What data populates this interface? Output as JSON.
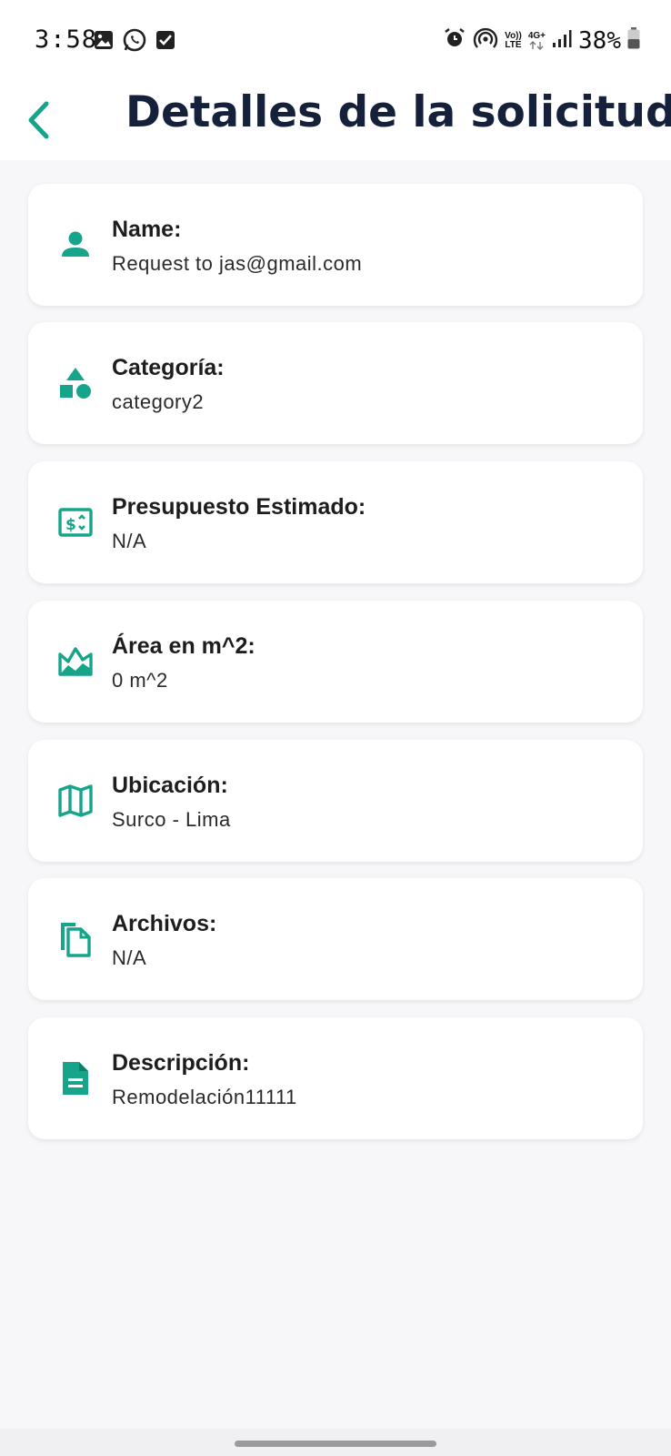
{
  "status_bar": {
    "time": "3:58",
    "battery": "38%",
    "network": "4G+",
    "volte_top": "Vo))",
    "volte_bottom": "LTE"
  },
  "header": {
    "title": "Detalles de la solicitud"
  },
  "accent_color": "#16a58b",
  "cards": [
    {
      "icon": "person-icon",
      "label": "Name:",
      "value": "Request to jas@gmail.com"
    },
    {
      "icon": "category-icon",
      "label": "Categoría:",
      "value": "category2"
    },
    {
      "icon": "money-icon",
      "label": "Presupuesto Estimado:",
      "value": "N/A"
    },
    {
      "icon": "area-chart-icon",
      "label": "Área en m^2:",
      "value": "0 m^2"
    },
    {
      "icon": "map-icon",
      "label": "Ubicación:",
      "value": "Surco - Lima"
    },
    {
      "icon": "files-icon",
      "label": "Archivos:",
      "value": "N/A"
    },
    {
      "icon": "document-icon",
      "label": "Descripción:",
      "value": "Remodelación11111"
    }
  ]
}
